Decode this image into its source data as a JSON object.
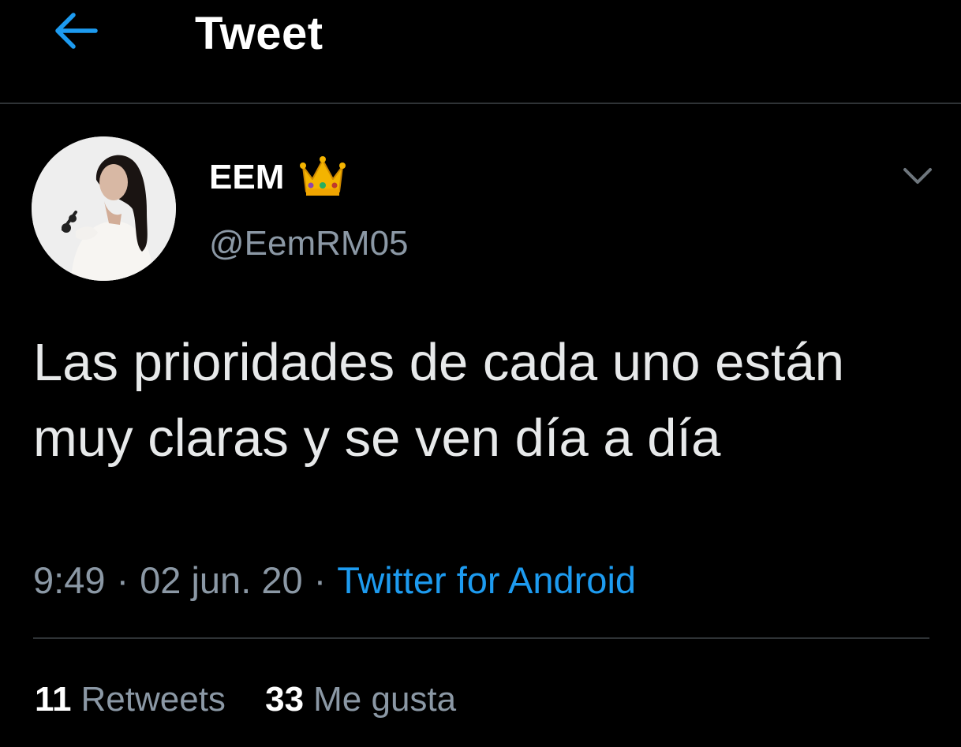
{
  "header": {
    "title": "Tweet",
    "back_icon": "arrow-left-icon"
  },
  "author": {
    "display_name": "EEM",
    "badge_emoji": "crown-icon",
    "handle": "@EemRM05"
  },
  "tweet": {
    "text": "Las prioridades de cada uno están muy claras y se ven día a día",
    "time": "9:49",
    "date": "02 jun. 20",
    "separator": "·",
    "source": "Twitter for Android"
  },
  "stats": {
    "retweets_count": "11",
    "retweets_label": "Retweets",
    "likes_count": "33",
    "likes_label": "Me gusta"
  },
  "colors": {
    "background": "#000000",
    "accent": "#1d9bf0",
    "secondary_text": "#8b98a5",
    "divider": "#2f3336"
  }
}
